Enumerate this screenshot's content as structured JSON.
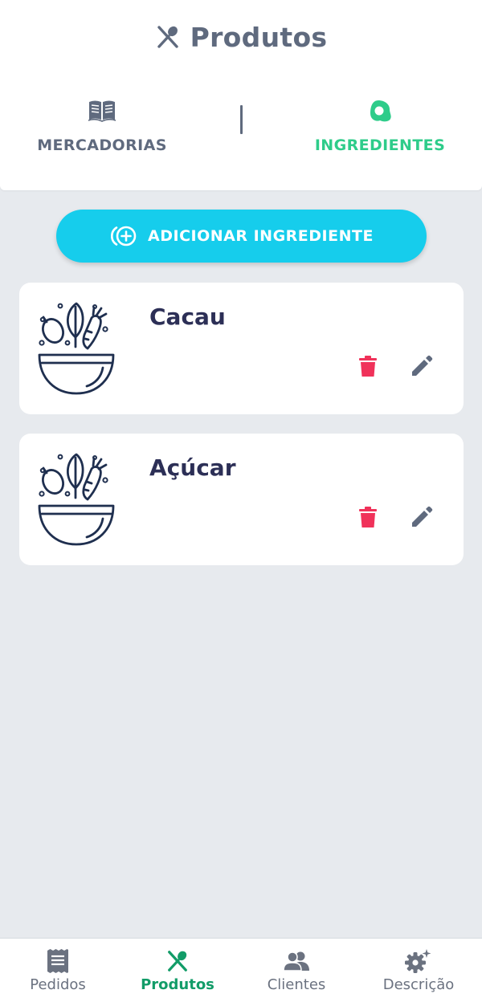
{
  "header": {
    "title": "Produtos",
    "title_icon": "utensils-icon"
  },
  "tabs": [
    {
      "label": "MERCADORIAS",
      "icon": "book-icon",
      "active": false
    },
    {
      "label": "INGREDIENTES",
      "icon": "ingredient-icon",
      "active": true
    }
  ],
  "add_button": {
    "label": "ADICIONAR INGREDIENTE",
    "icon": "add-circle-icon"
  },
  "ingredients": [
    {
      "name": "Cacau",
      "image": "salad-bowl-icon"
    },
    {
      "name": "Açúcar",
      "image": "salad-bowl-icon"
    }
  ],
  "bottom_nav": [
    {
      "label": "Pedidos",
      "icon": "receipt-icon",
      "active": false
    },
    {
      "label": "Produtos",
      "icon": "utensils-icon",
      "active": true
    },
    {
      "label": "Clientes",
      "icon": "users-icon",
      "active": false
    },
    {
      "label": "Descrição",
      "icon": "gear-icon",
      "active": false
    }
  ],
  "colors": {
    "accent": "#16cdec",
    "active_tab": "#2ecc8a",
    "active_nav": "#129c68",
    "delete": "#f0325a",
    "text_dark": "#2c2f56",
    "text_muted": "#5f6a7e",
    "background": "#e7eaee"
  }
}
